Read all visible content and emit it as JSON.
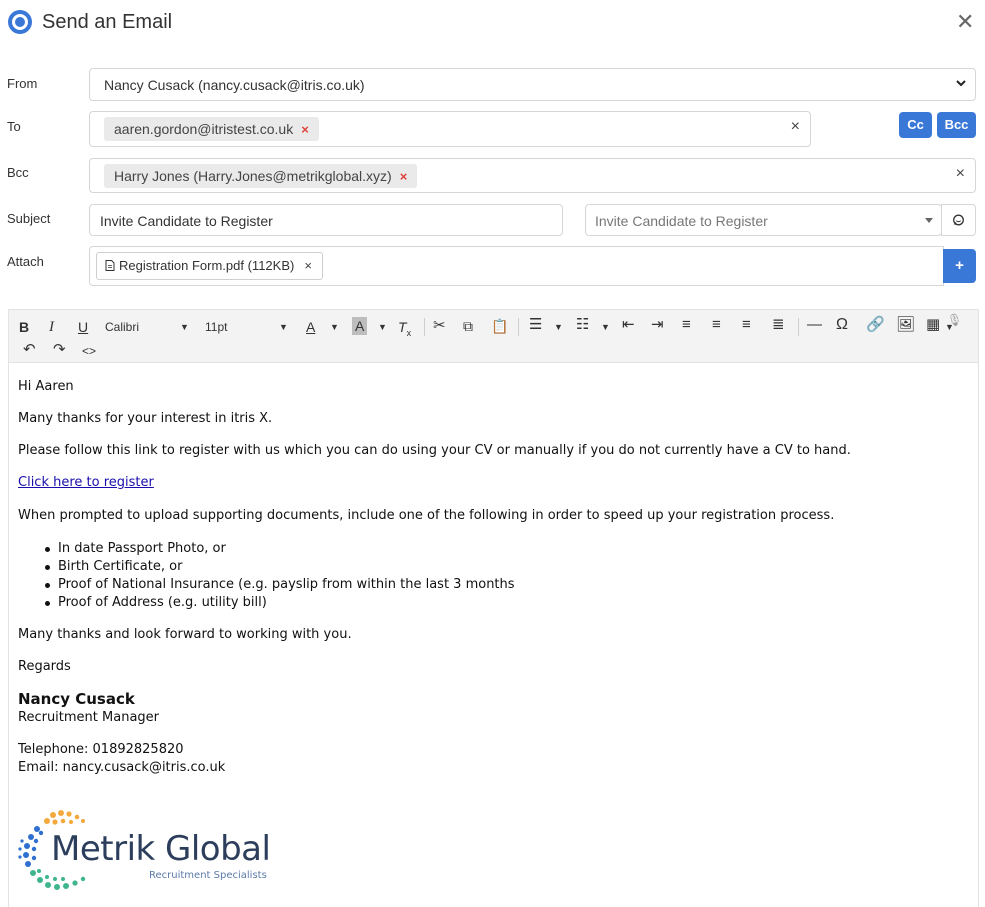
{
  "header": {
    "title": "Send an Email"
  },
  "labels": {
    "from": "From",
    "to": "To",
    "bcc": "Bcc",
    "subject": "Subject",
    "attach": "Attach"
  },
  "from": {
    "value": "Nancy Cusack (nancy.cusack@itris.co.uk)"
  },
  "to": {
    "recipients": [
      "aaren.gordon@itristest.co.uk"
    ],
    "remove_glyph": "×",
    "clear_glyph": "×"
  },
  "buttons": {
    "cc": "Cc",
    "bcc": "Bcc",
    "attach_add": "+"
  },
  "bcc": {
    "recipients": [
      "Harry Jones (Harry.Jones@metrikglobal.xyz)"
    ],
    "remove_glyph": "×",
    "clear_glyph": "×"
  },
  "subject": {
    "value": "Invite Candidate to Register",
    "template_placeholder": "Invite Candidate to Register"
  },
  "attachments": [
    {
      "name": "Registration Form.pdf (112KB)",
      "remove_glyph": "×"
    }
  ],
  "toolbar": {
    "font_family": "Calibri",
    "font_size": "11pt"
  },
  "email": {
    "greeting": "Hi Aaren",
    "line1": "Many thanks for your interest in itris X.",
    "line2": "Please follow this link to register with us which you can do using your CV or manually if you do not currently have a CV to hand.",
    "link_text": "Click here to register",
    "line3": "When prompted to upload supporting documents, include one of the following in order to speed up your registration process.",
    "bullets": [
      "In date Passport Photo, or",
      "Birth Certificate, or",
      "Proof of National Insurance (e.g. payslip from within the last 3 months",
      "Proof of Address (e.g. utility bill)"
    ],
    "closing": "Many thanks and look forward to working with you.",
    "regards": "Regards",
    "sig_name": "Nancy Cusack",
    "sig_title": "Recruitment Manager",
    "sig_phone": "Telephone: 01892825820",
    "sig_email": "Email: nancy.cusack@itris.co.uk",
    "logo_name": "Metrik Global",
    "logo_tagline": "Recruitment Specialists"
  },
  "colors": {
    "accent": "#3a78d8",
    "chip_remove": "#e0413a",
    "link": "#1a0dab"
  }
}
